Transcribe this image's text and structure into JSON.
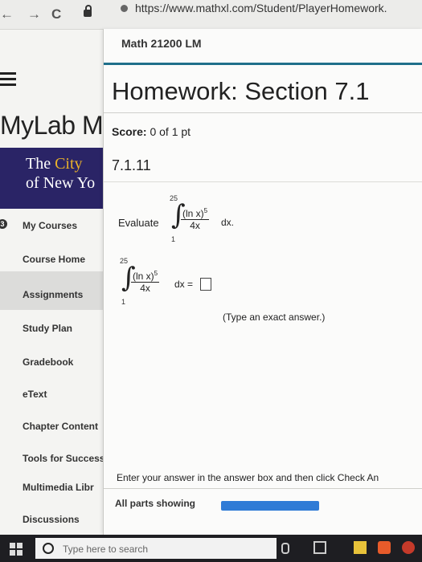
{
  "browser": {
    "back_glyph": "←",
    "forward_glyph": "→",
    "reload_glyph": "C",
    "url": "https://www.mathxl.com/Student/PlayerHomework."
  },
  "app": {
    "brand": "MyLab M",
    "banner_line1_a": "The ",
    "banner_line1_b": "City ",
    "banner_line2": "of New Yo"
  },
  "sidebar": {
    "items": [
      {
        "label": "My Courses"
      },
      {
        "label": "Course Home"
      },
      {
        "label": "Assignments"
      },
      {
        "label": "Study Plan"
      },
      {
        "label": "Gradebook"
      },
      {
        "label": "eText"
      },
      {
        "label": "Chapter Content"
      },
      {
        "label": "Tools for Success"
      },
      {
        "label": "Multimedia Libr"
      },
      {
        "label": "Discussions"
      }
    ]
  },
  "panel": {
    "course": "Math 21200 LM",
    "title": "Homework: Section 7.1",
    "score_label": "Score:",
    "score_value": "0 of 1 pt",
    "problem_number": "7.1.11",
    "evaluate_label": "Evaluate",
    "upper_limit": "25",
    "lower_limit": "1",
    "numerator": "(ln x)",
    "exponent": "5",
    "denominator": "4x",
    "dx_text": "dx.",
    "answer_eq": "dx =",
    "hint": "(Type an exact answer.)",
    "instruction": "Enter your answer in the answer box and then click Check An",
    "parts_label": "All parts showing",
    "progress_fraction": 1.0
  },
  "taskbar": {
    "search_placeholder": "Type here to search"
  }
}
